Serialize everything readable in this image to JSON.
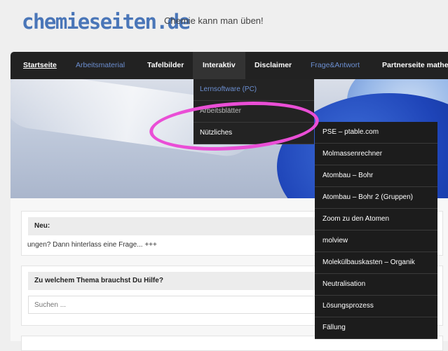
{
  "site": {
    "title": "chemieseiten.de",
    "tagline": "Chemie kann man üben!"
  },
  "nav": {
    "items": [
      {
        "label": "Startseite"
      },
      {
        "label": "Arbeitsmaterial"
      },
      {
        "label": "Tafelbilder"
      },
      {
        "label": "Interaktiv"
      },
      {
        "label": "Disclaimer"
      },
      {
        "label": "Frage&Antwort"
      },
      {
        "label": "Partnerseite mathe-"
      }
    ]
  },
  "interaktiv_menu": {
    "items": [
      {
        "label": "Lernsoftware (PC)"
      },
      {
        "label": "Arbeitsblätter"
      },
      {
        "label": "Nützliches"
      }
    ]
  },
  "nuetzliches_menu": {
    "items": [
      {
        "label": "PSE – ptable.com"
      },
      {
        "label": "Molmassenrechner"
      },
      {
        "label": "Atombau – Bohr"
      },
      {
        "label": "Atombau – Bohr 2 (Gruppen)"
      },
      {
        "label": "Zoom zu den Atomen"
      },
      {
        "label": "molview"
      },
      {
        "label": "Molekülbauskasten – Organik"
      },
      {
        "label": "Neutralisation"
      },
      {
        "label": "Lösungsprozess"
      },
      {
        "label": "Fällung"
      }
    ]
  },
  "widgets": {
    "news": {
      "title": "Neu:",
      "ticker": "ungen? Dann hinterlass eine Frage... +++"
    },
    "help": {
      "title": "Zu welchem Thema brauchst Du Hilfe?",
      "search_placeholder": "Suchen ..."
    }
  },
  "colors": {
    "accent_blue": "#4a76b8",
    "nav_bg": "#222222",
    "highlight": "#ea4ed6"
  }
}
